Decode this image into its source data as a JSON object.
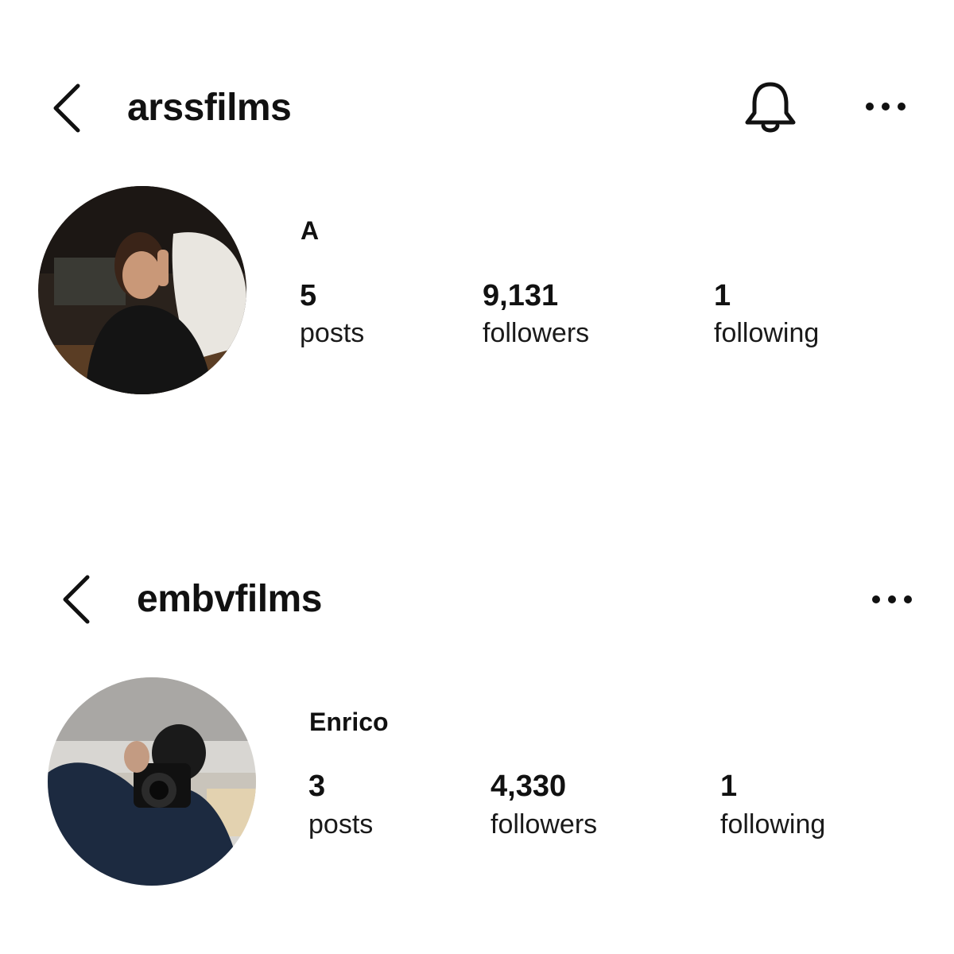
{
  "profiles": [
    {
      "username": "arssfilms",
      "display_name": "A",
      "stats": {
        "posts": {
          "value": "5",
          "label": "posts"
        },
        "followers": {
          "value": "9,131",
          "label": "followers"
        },
        "following": {
          "value": "1",
          "label": "following"
        }
      },
      "icons": [
        "chevron-left-icon",
        "bell-icon",
        "more-icon"
      ]
    },
    {
      "username": "embvfilms",
      "display_name": "Enrico",
      "stats": {
        "posts": {
          "value": "3",
          "label": "posts"
        },
        "followers": {
          "value": "4,330",
          "label": "followers"
        },
        "following": {
          "value": "1",
          "label": "following"
        }
      },
      "icons": [
        "chevron-left-icon",
        "more-icon"
      ]
    }
  ]
}
